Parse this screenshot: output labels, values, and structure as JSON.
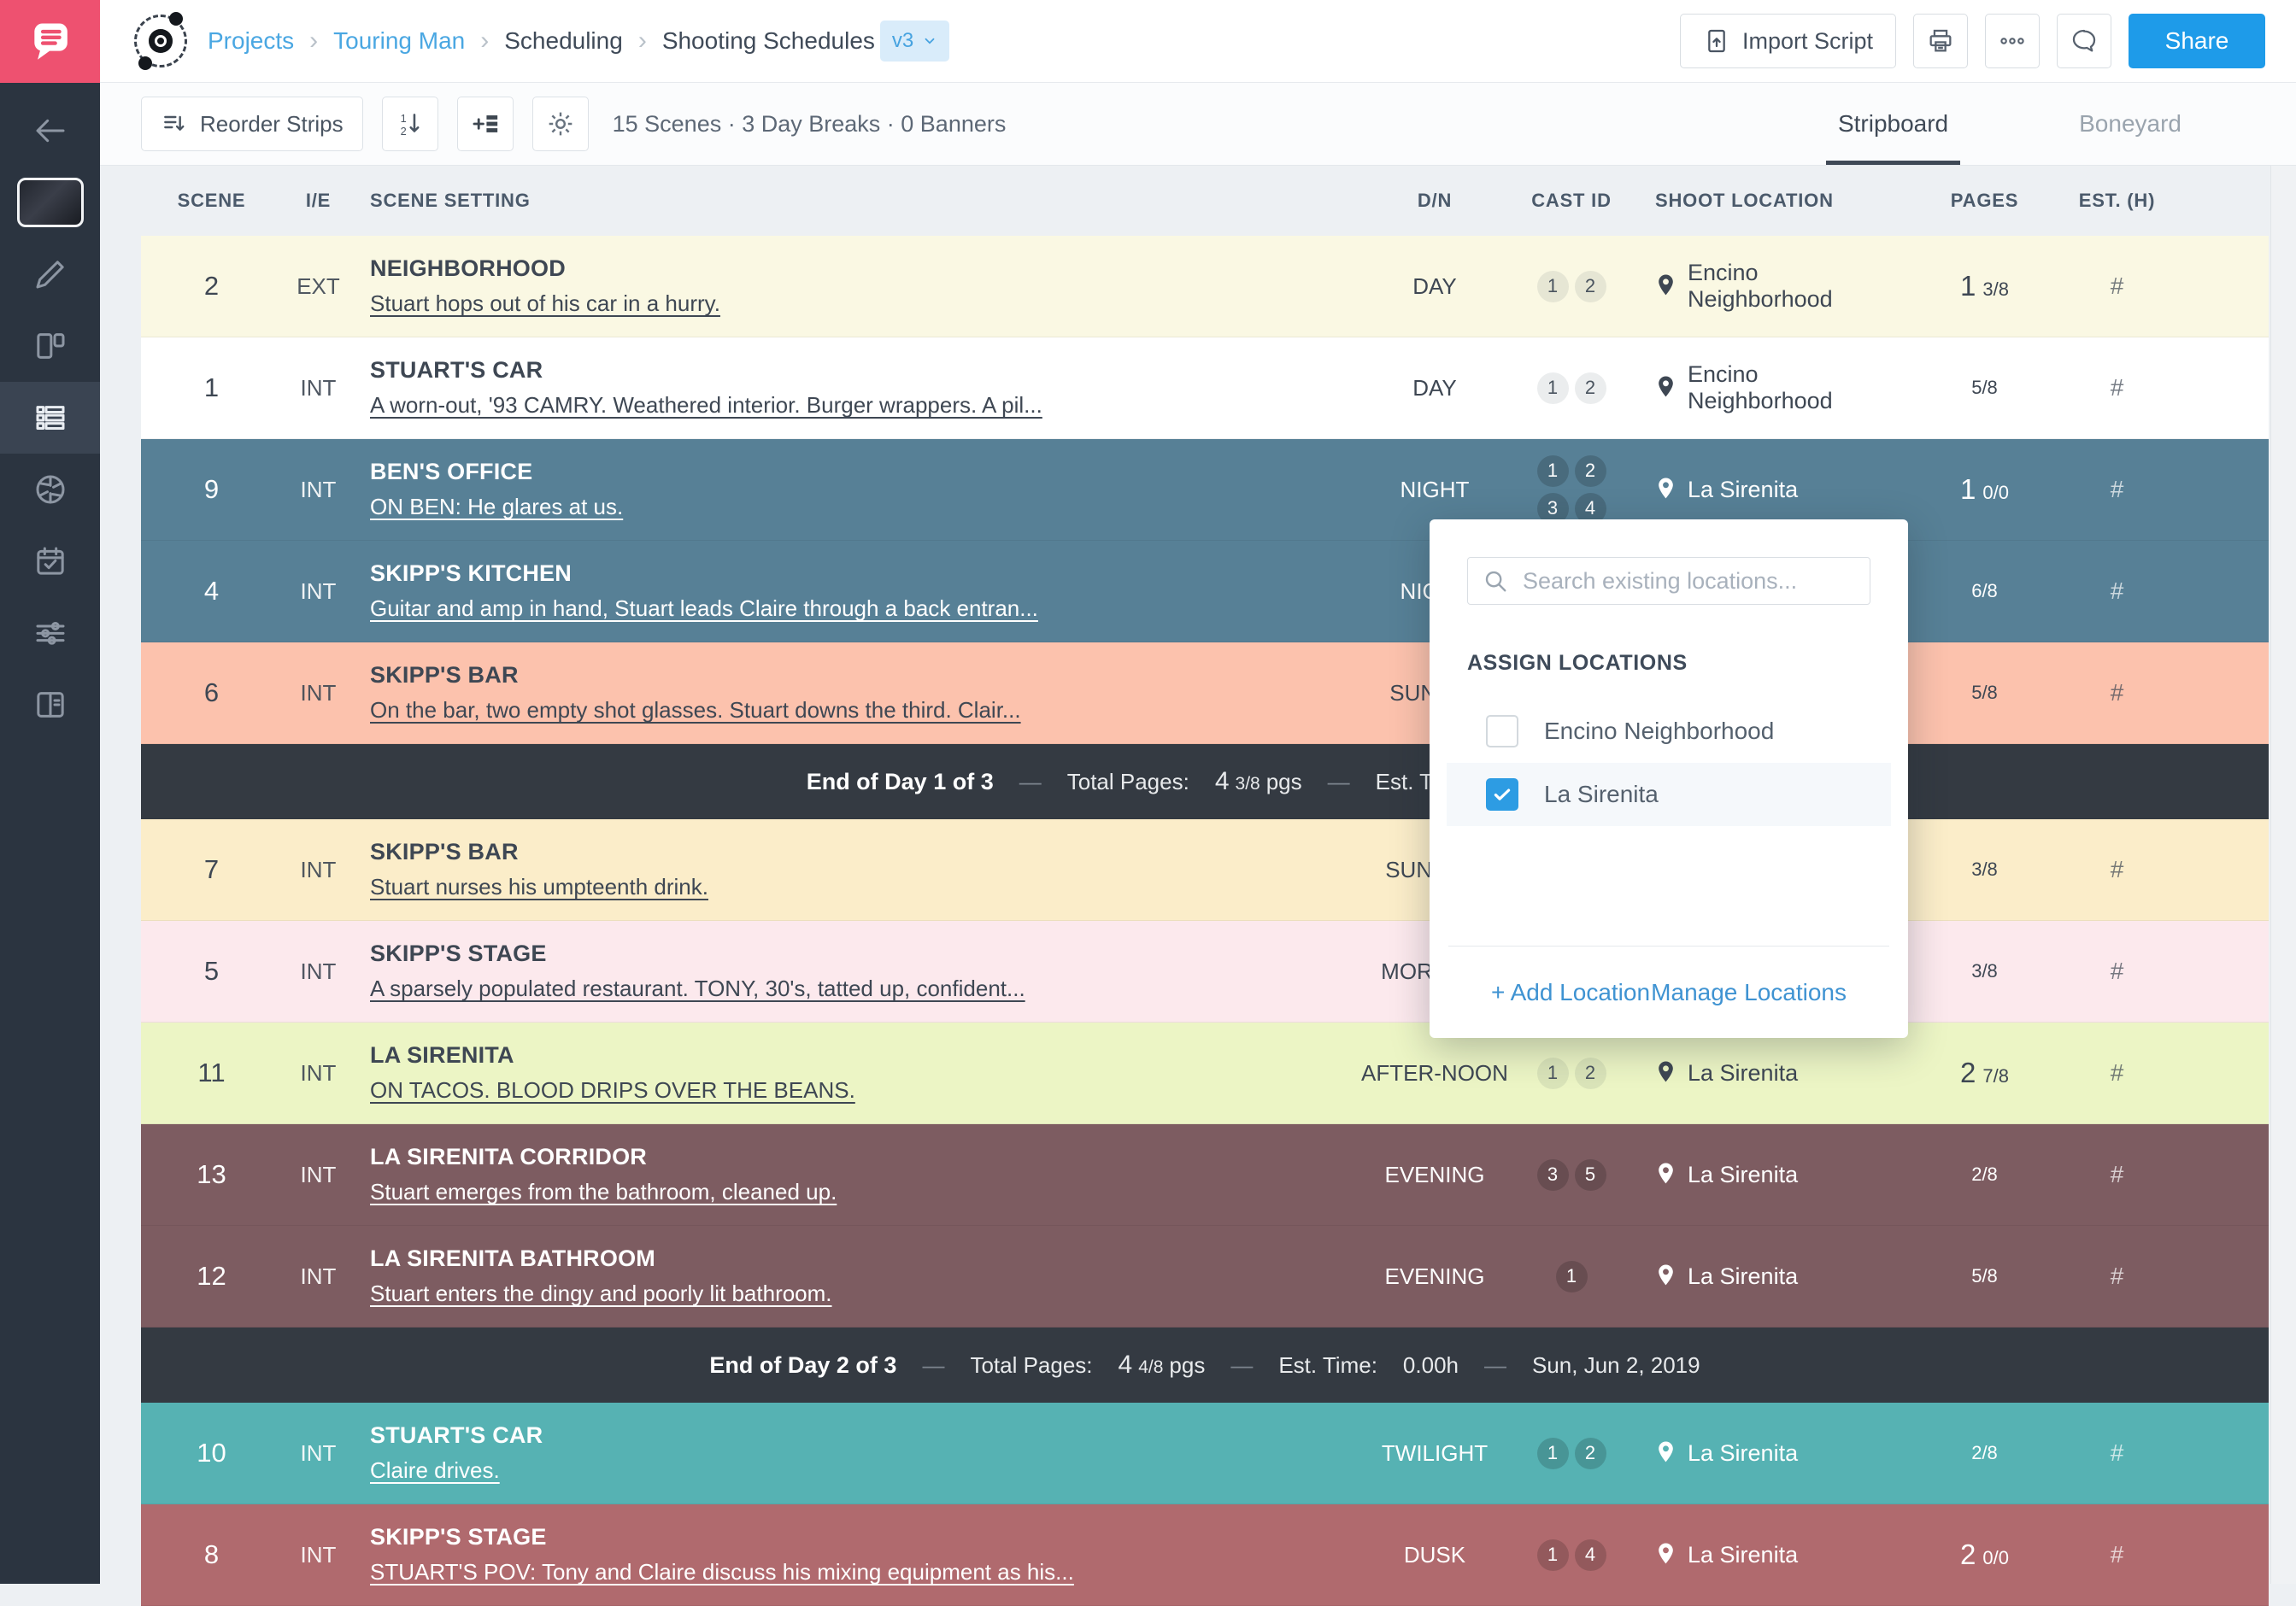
{
  "header": {
    "breadcrumbs": [
      {
        "label": "Projects",
        "link": true
      },
      {
        "label": "Touring Man",
        "link": true
      },
      {
        "label": "Scheduling",
        "link": false
      },
      {
        "label": "Shooting Schedules",
        "link": false
      }
    ],
    "version_badge": "v3",
    "import_label": "Import Script",
    "share_label": "Share"
  },
  "toolbar": {
    "reorder_label": "Reorder Strips",
    "summary": "15 Scenes · 3 Day Breaks · 0 Banners",
    "tabs": [
      {
        "label": "Stripboard",
        "active": true
      },
      {
        "label": "Boneyard",
        "active": false
      }
    ]
  },
  "table": {
    "columns": [
      "SCENE",
      "I/E",
      "SCENE SETTING",
      "D/N",
      "CAST ID",
      "SHOOT LOCATION",
      "PAGES",
      "EST. (H)"
    ]
  },
  "day_break_labels": {
    "total_label": "Total Pages:",
    "unit": "pgs",
    "est_label": "Est. Time:",
    "est_value": "0.00h",
    "separator": "—"
  },
  "strips": [
    {
      "kind": "scene",
      "num": "2",
      "ie": "EXT",
      "title": "NEIGHBORHOOD",
      "desc": "Stuart hops out of his car in a hurry.",
      "dn": "DAY",
      "cast": [
        "1",
        "2"
      ],
      "loc": "Encino Neighborhood",
      "pw": "1",
      "pf": "3/8",
      "est": "#",
      "theme": "cream",
      "text": "dark"
    },
    {
      "kind": "scene",
      "num": "1",
      "ie": "INT",
      "title": "STUART'S CAR",
      "desc": "A worn-out, '93 CAMRY. Weathered interior. Burger wrappers. A pil...",
      "dn": "DAY",
      "cast": [
        "1",
        "2"
      ],
      "loc": "Encino Neighborhood",
      "pw": "",
      "pf": "5/8",
      "est": "#",
      "theme": "whitebg",
      "text": "dark"
    },
    {
      "kind": "scene",
      "num": "9",
      "ie": "INT",
      "title": "BEN'S OFFICE",
      "desc": "ON BEN: He glares at us.",
      "dn": "NIGHT",
      "cast": [
        "1",
        "2",
        "3",
        "4"
      ],
      "loc": "La Sirenita",
      "pw": "1",
      "pf": "0/0",
      "est": "#",
      "theme": "slate",
      "text": "light"
    },
    {
      "kind": "scene",
      "num": "4",
      "ie": "INT",
      "title": "SKIPP'S KITCHEN",
      "desc": "Guitar and amp in hand, Stuart leads Claire through a back entran...",
      "dn": "NIGHT",
      "cast": [],
      "loc": "",
      "pw": "",
      "pf": "6/8",
      "est": "#",
      "theme": "slate",
      "text": "light"
    },
    {
      "kind": "scene",
      "num": "6",
      "ie": "INT",
      "title": "SKIPP'S BAR",
      "desc": "On the bar, two empty shot glasses. Stuart downs the third. Clair...",
      "dn": "SUNSET",
      "cast": [],
      "loc": "",
      "pw": "",
      "pf": "5/8",
      "est": "#",
      "theme": "salmon",
      "text": "dark"
    },
    {
      "kind": "break",
      "title": "End of Day 1 of 3",
      "total_whole": "4",
      "total_frac": "3/8",
      "date": ""
    },
    {
      "kind": "scene",
      "num": "7",
      "ie": "INT",
      "title": "SKIPP'S BAR",
      "desc": "Stuart nurses his umpteenth drink.",
      "dn": "SUNRISE",
      "cast": [],
      "loc": "",
      "pw": "",
      "pf": "3/8",
      "est": "#",
      "theme": "wheat",
      "text": "dark"
    },
    {
      "kind": "scene",
      "num": "5",
      "ie": "INT",
      "title": "SKIPP'S STAGE",
      "desc": "A sparsely populated restaurant. TONY, 30's, tatted up, confident...",
      "dn": "MORNING",
      "cast": [],
      "loc": "",
      "pw": "",
      "pf": "3/8",
      "est": "#",
      "theme": "pinkish",
      "text": "dark"
    },
    {
      "kind": "scene",
      "num": "11",
      "ie": "INT",
      "title": "LA SIRENITA",
      "desc": "ON TACOS. BLOOD DRIPS OVER THE BEANS.",
      "dn": "AFTER-NOON",
      "cast": [
        "1",
        "2"
      ],
      "loc": "La Sirenita",
      "pw": "2",
      "pf": "7/8",
      "est": "#",
      "theme": "green",
      "text": "dark"
    },
    {
      "kind": "scene",
      "num": "13",
      "ie": "INT",
      "title": "LA SIRENITA CORRIDOR",
      "desc": "Stuart emerges from the bathroom, cleaned up.",
      "dn": "EVENING",
      "cast": [
        "3",
        "5"
      ],
      "loc": "La Sirenita",
      "pw": "",
      "pf": "2/8",
      "est": "#",
      "theme": "mauve",
      "text": "light"
    },
    {
      "kind": "scene",
      "num": "12",
      "ie": "INT",
      "title": "LA SIRENITA BATHROOM",
      "desc": "Stuart enters the dingy and poorly lit bathroom.",
      "dn": "EVENING",
      "cast": [
        "1"
      ],
      "loc": "La Sirenita",
      "pw": "",
      "pf": "5/8",
      "est": "#",
      "theme": "mauve",
      "text": "light"
    },
    {
      "kind": "break",
      "title": "End of Day 2 of 3",
      "total_whole": "4",
      "total_frac": "4/8",
      "date": "Sun, Jun 2, 2019"
    },
    {
      "kind": "scene",
      "num": "10",
      "ie": "INT",
      "title": "STUART'S CAR",
      "desc": "Claire drives.",
      "dn": "TWILIGHT",
      "cast": [
        "1",
        "2"
      ],
      "loc": "La Sirenita",
      "pw": "",
      "pf": "2/8",
      "est": "#",
      "theme": "teal",
      "text": "light"
    },
    {
      "kind": "scene",
      "num": "8",
      "ie": "INT",
      "title": "SKIPP'S STAGE",
      "desc": "STUART'S POV: Tony and Claire discuss his mixing equipment as his...",
      "dn": "DUSK",
      "cast": [
        "1",
        "4"
      ],
      "loc": "La Sirenita",
      "pw": "2",
      "pf": "0/0",
      "est": "#",
      "theme": "brick",
      "text": "light"
    }
  ],
  "popup": {
    "search_placeholder": "Search existing locations...",
    "section_title": "ASSIGN LOCATIONS",
    "options": [
      {
        "label": "Encino Neighborhood",
        "checked": false
      },
      {
        "label": "La Sirenita",
        "checked": true
      }
    ],
    "add_label": "+ Add Location",
    "manage_label": "Manage Locations"
  },
  "sidebar": {
    "items": [
      {
        "icon": "back-arrow",
        "active": false
      },
      {
        "icon": "project-thumbnail",
        "active": false
      },
      {
        "icon": "pencil",
        "active": false
      },
      {
        "icon": "pages",
        "active": false
      },
      {
        "icon": "stripboard",
        "active": true
      },
      {
        "icon": "aperture",
        "active": false
      },
      {
        "icon": "calendar-check",
        "active": false
      },
      {
        "icon": "sliders",
        "active": false
      },
      {
        "icon": "contacts-book",
        "active": false
      }
    ]
  },
  "colors": {
    "brand": "#ee5170",
    "accent_blue": "#1e9be9",
    "link_blue": "#4aa7e2"
  }
}
